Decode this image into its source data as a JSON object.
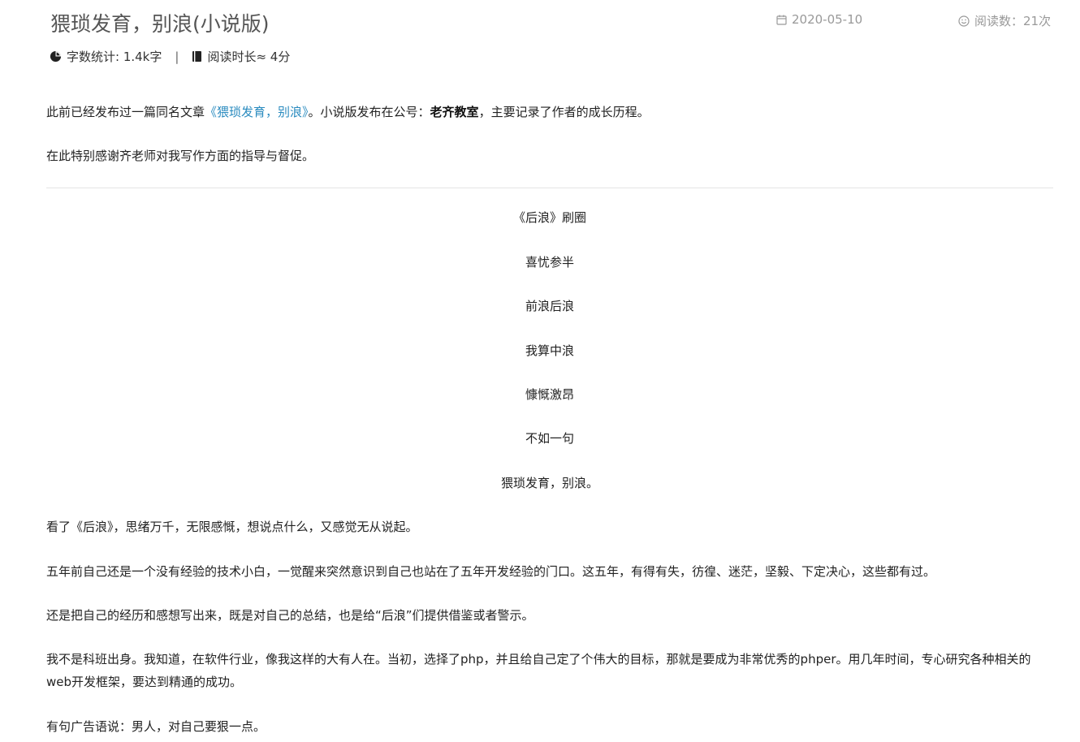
{
  "header": {
    "title": "猥琐发育，别浪(小说版)",
    "date": "2020-05-10",
    "views": "阅读数：21次",
    "word_count": "字数统计: 1.4k字",
    "separator": "|",
    "read_time": "阅读时长≈ 4分"
  },
  "intro": {
    "p1_before": "此前已经发布过一篇同名文章",
    "p1_link": "《猥琐发育，别浪》",
    "p1_mid": "。小说版发布在公号：",
    "p1_bold": "老齐教室",
    "p1_after": "，主要记录了作者的成长历程。",
    "p2": "在此特别感谢齐老师对我写作方面的指导与督促。"
  },
  "poem": [
    "《后浪》刷圈",
    "喜忧参半",
    "前浪后浪",
    "我算中浪",
    "慷慨激昂",
    "不如一句",
    "猥琐发育，别浪。"
  ],
  "body": {
    "p1": "看了《后浪》，思绪万千，无限感慨，想说点什么，又感觉无从说起。",
    "p2": "五年前自己还是一个没有经验的技术小白，一觉醒来突然意识到自己也站在了五年开发经验的门口。这五年，有得有失，彷徨、迷茫，坚毅、下定决心，这些都有过。",
    "p3": "还是把自己的经历和感想写出来，既是对自己的总结，也是给“后浪”们提供借鉴或者警示。",
    "p4": "我不是科班出身。我知道，在软件行业，像我这样的大有人在。当初，选择了php，并且给自己定了个伟大的目标，那就是要成为非常优秀的phper。用几年时间，专心研究各种相关的web开发框架，要达到精通的成功。",
    "p5": "有句广告语说：男人，对自己要狠一点。"
  }
}
